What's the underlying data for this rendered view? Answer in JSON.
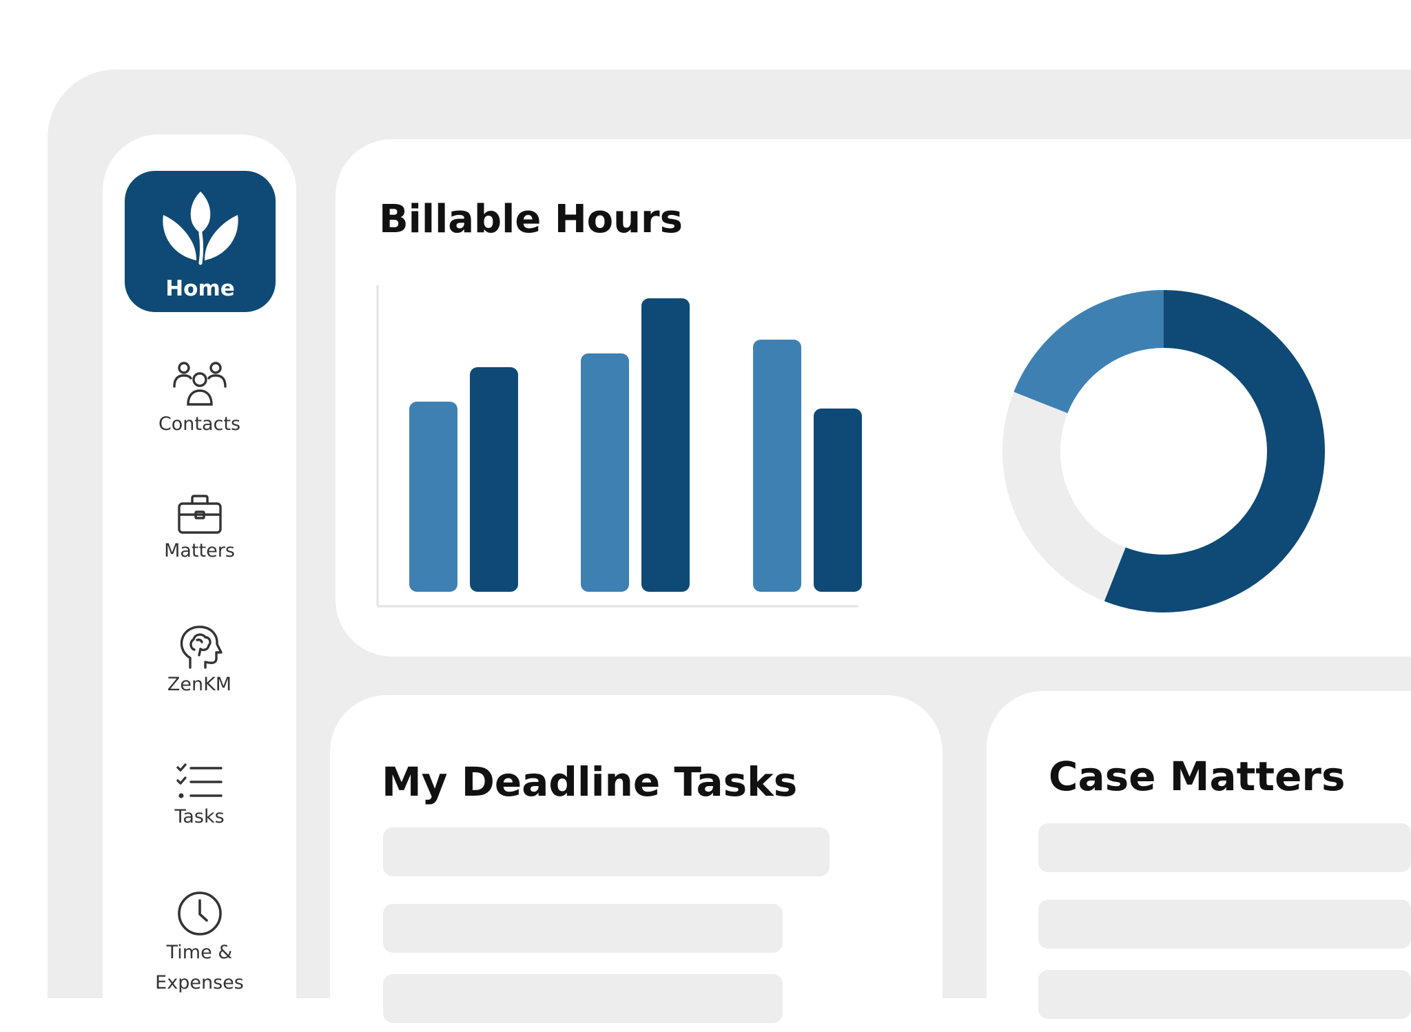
{
  "sidebar": {
    "home": {
      "label": "Home",
      "icon": "lotus-icon"
    },
    "items": [
      {
        "label": "Contacts",
        "icon": "contacts-icon"
      },
      {
        "label": "Matters",
        "icon": "briefcase-icon"
      },
      {
        "label": "ZenKM",
        "icon": "head-brain-icon"
      },
      {
        "label": "Tasks",
        "icon": "checklist-icon"
      },
      {
        "label": "Time &",
        "label_line2": "Expenses",
        "icon": "clock-icon"
      }
    ]
  },
  "billable_hours": {
    "title": "Billable Hours"
  },
  "deadline_tasks": {
    "title": "My Deadline Tasks"
  },
  "case_matters": {
    "title": "Case Matters"
  },
  "colors": {
    "primary": "#0e4a75",
    "secondary": "#3f80b3",
    "frame": "#ededed",
    "donut_empty": "#ededed"
  },
  "chart_data": [
    {
      "type": "bar",
      "categories": [
        "",
        "",
        ""
      ],
      "series": [
        {
          "values": [
            27,
            34,
            36
          ]
        },
        {
          "values": [
            32,
            42,
            26
          ]
        }
      ],
      "ylim": [
        0,
        45
      ],
      "title": "",
      "xlabel": "",
      "ylabel": ""
    },
    {
      "type": "pie",
      "style": "donut",
      "values": [
        56,
        25,
        19
      ],
      "colors": [
        "#0e4a75",
        "#ededed",
        "#3f80b3"
      ]
    }
  ]
}
